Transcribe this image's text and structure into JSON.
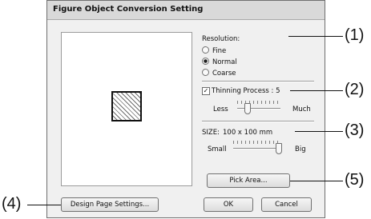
{
  "dialog": {
    "title": "Figure Object Conversion Setting"
  },
  "resolution": {
    "label": "Resolution:",
    "options": [
      "Fine",
      "Normal",
      "Coarse"
    ],
    "selected_index": 1
  },
  "thinning": {
    "label": "Thinning Process : 5",
    "checked": true,
    "check_glyph": "✓",
    "min_label": "Less",
    "max_label": "Much"
  },
  "size": {
    "label": "SIZE:",
    "value": "100 x 100 mm",
    "min_label": "Small",
    "max_label": "Big"
  },
  "buttons": {
    "pick_area": "Pick Area...",
    "design_page_settings": "Design Page Settings...",
    "ok": "OK",
    "cancel": "Cancel"
  },
  "callouts": [
    "(1)",
    "(2)",
    "(3)",
    "(4)",
    "(5)"
  ],
  "colors": {
    "dialog_bg": "#f0f0f0",
    "title_bar": "#d9d9d9"
  }
}
